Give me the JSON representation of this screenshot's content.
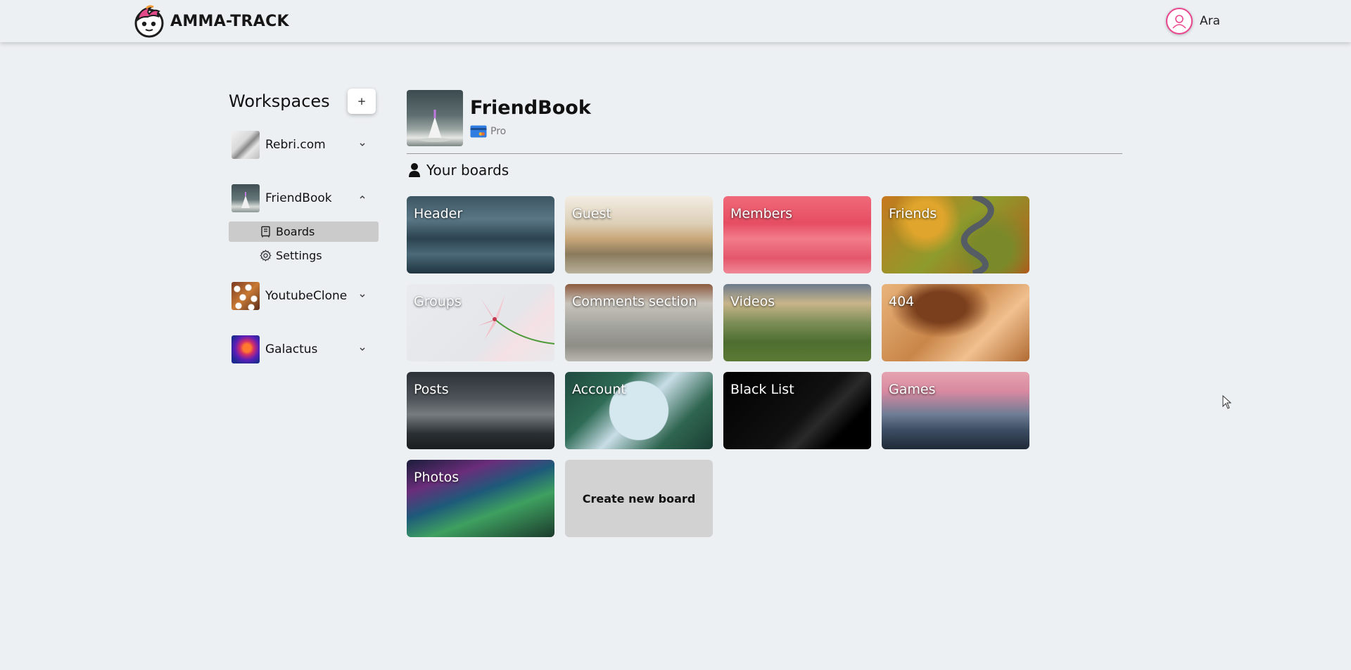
{
  "app": {
    "brand_name": "AMMA-TRACK",
    "user_name": "Ara"
  },
  "sidebar": {
    "title": "Workspaces",
    "add_label": "+",
    "workspaces": [
      {
        "label": "Rebri.com",
        "expanded": false
      },
      {
        "label": "FriendBook",
        "expanded": true
      },
      {
        "label": "YoutubeClone",
        "expanded": false
      },
      {
        "label": "Galactus",
        "expanded": false
      }
    ],
    "subitems": [
      {
        "label": "Boards",
        "active": true,
        "icon": "board-icon"
      },
      {
        "label": "Settings",
        "active": false,
        "icon": "gear-icon"
      }
    ]
  },
  "workspace": {
    "name": "FriendBook",
    "plan": "Pro",
    "plan_icon": "credit-card-icon"
  },
  "boards_section": {
    "title": "Your boards",
    "icon": "user-icon",
    "boards": [
      {
        "title": "Header"
      },
      {
        "title": "Guest"
      },
      {
        "title": "Members"
      },
      {
        "title": "Friends"
      },
      {
        "title": "Groups"
      },
      {
        "title": "Comments section"
      },
      {
        "title": "Videos"
      },
      {
        "title": "404"
      },
      {
        "title": "Posts"
      },
      {
        "title": "Account"
      },
      {
        "title": "Black List"
      },
      {
        "title": "Games"
      },
      {
        "title": "Photos"
      }
    ],
    "create_label": "Create new board"
  },
  "colors": {
    "background": "#edf0f3",
    "accent_pink": "#e9468f",
    "active_item": "#cbcbcb",
    "create_tile": "#d2d2d2"
  }
}
